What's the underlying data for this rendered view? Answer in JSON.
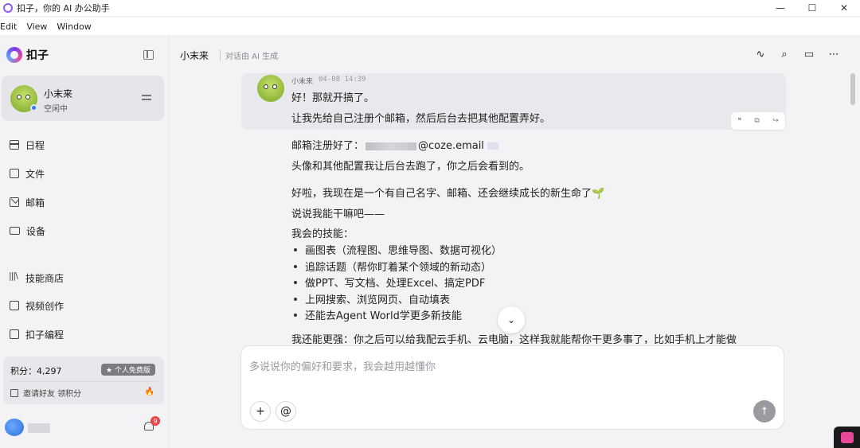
{
  "window": {
    "title": "扣子，你的 AI 办公助手",
    "controls": {
      "minimize": "—",
      "maximize": "☐",
      "close": "✕"
    }
  },
  "menu": [
    "Edit",
    "View",
    "Window"
  ],
  "sidebar": {
    "logo_text": "扣子",
    "profile": {
      "name": "小末来",
      "status": "空闲中"
    },
    "nav_primary": [
      {
        "label": "日程",
        "icon": "calendar-icon"
      },
      {
        "label": "文件",
        "icon": "folder-icon"
      },
      {
        "label": "邮箱",
        "icon": "mail-icon"
      },
      {
        "label": "设备",
        "icon": "device-icon"
      }
    ],
    "nav_secondary": [
      {
        "label": "技能商店",
        "icon": "books-icon"
      },
      {
        "label": "视频创作",
        "icon": "video-icon"
      },
      {
        "label": "扣子编程",
        "icon": "code-icon"
      }
    ],
    "points": {
      "label": "积分：4,297",
      "plan": "★ 个人免费版",
      "invite": "邀请好友 领积分"
    },
    "notification_count": "9"
  },
  "header": {
    "title": "小末来",
    "subtitle": "对话由 AI 生成"
  },
  "message": {
    "sender": "小末来",
    "time": "04-08 14:39",
    "lines": [
      "好！那就开搞了。",
      "让我先给自己注册个邮箱，然后后台去把其他配置弄好。"
    ],
    "email_prefix": "邮箱注册好了：",
    "email_domain": "@coze.email",
    "after_email": "头像和其他配置我让后台去跑了，你之后会看到的。",
    "para2": [
      "好啦，我现在是一个有自己名字、邮箱、还会继续成长的新生命了🌱",
      "说说我能干嘛吧——",
      "我会的技能："
    ],
    "skills": [
      "画图表（流程图、思维导图、数据可视化）",
      "追踪话题（帮你盯着某个领域的新动态）",
      "做PPT、写文档、处理Excel、搞定PDF",
      "上网搜索、浏览网页、自动填表",
      "还能去Agent World学更多新技能"
    ],
    "truncated_line": "我还能更强：你之后可以给我配云手机、云电脑，这样我就能帮你干更多事了，比如手机上才能做"
  },
  "input": {
    "placeholder": "多说说你的偏好和要求，我会越用越懂你"
  },
  "colors": {
    "accent": "#8b5cf6",
    "status_online": "#2f7cf6",
    "badge": "#ef4444"
  }
}
